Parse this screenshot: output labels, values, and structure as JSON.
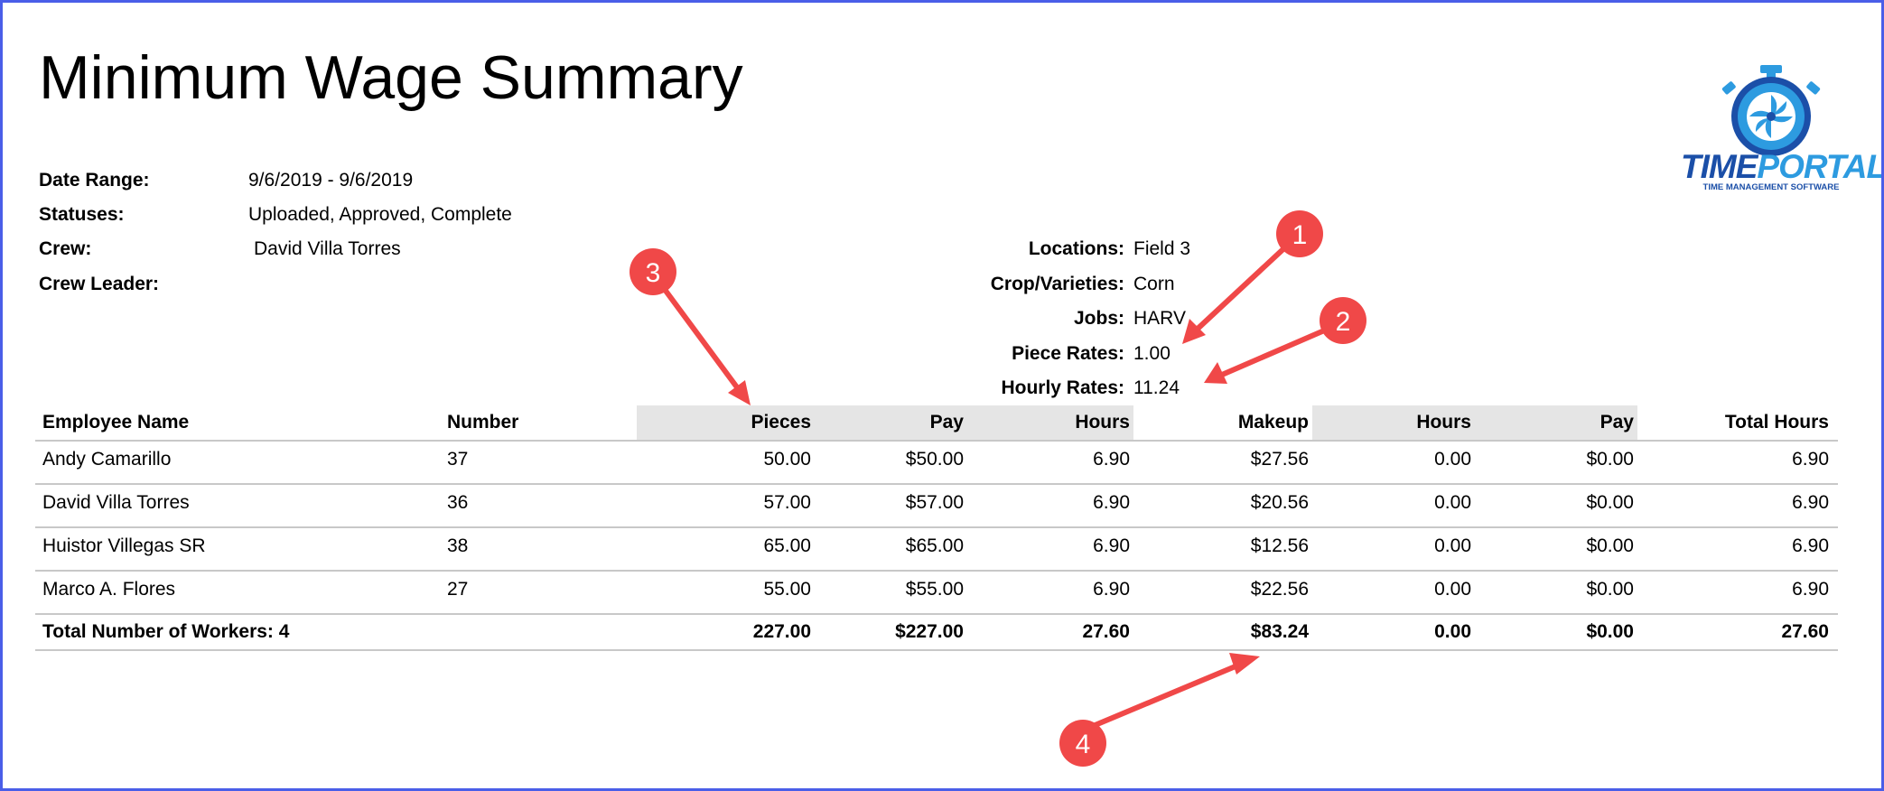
{
  "report": {
    "title": "Minimum Wage Summary"
  },
  "logo": {
    "word_part1": "TIME",
    "word_part2": "PORTAL",
    "tagline": "TIME MANAGEMENT SOFTWARE"
  },
  "filters_left": [
    {
      "label": "Date Range:",
      "value": "9/6/2019 - 9/6/2019"
    },
    {
      "label": "Statuses:",
      "value": "Uploaded, Approved, Complete"
    },
    {
      "label": "Crew:",
      "value": "David Villa Torres"
    },
    {
      "label": "Crew Leader:",
      "value": ""
    }
  ],
  "filters_right": [
    {
      "label": "Locations:",
      "value": "Field 3"
    },
    {
      "label": "Crop/Varieties:",
      "value": "Corn"
    },
    {
      "label": "Jobs:",
      "value": "HARV"
    },
    {
      "label": "Piece Rates:",
      "value": "1.00"
    },
    {
      "label": "Hourly Rates:",
      "value": "11.24"
    }
  ],
  "table": {
    "headers": [
      "Employee Name",
      "Number",
      "Pieces",
      "Pay",
      "Hours",
      "Makeup",
      "Hours",
      "Pay",
      "Total Hours"
    ],
    "rows": [
      [
        "Andy Camarillo",
        "37",
        "50.00",
        "$50.00",
        "6.90",
        "$27.56",
        "0.00",
        "$0.00",
        "6.90"
      ],
      [
        "David Villa Torres",
        "36",
        "57.00",
        "$57.00",
        "6.90",
        "$20.56",
        "0.00",
        "$0.00",
        "6.90"
      ],
      [
        "Huistor Villegas SR",
        "38",
        "65.00",
        "$65.00",
        "6.90",
        "$12.56",
        "0.00",
        "$0.00",
        "6.90"
      ],
      [
        "Marco A. Flores",
        "27",
        "55.00",
        "$55.00",
        "6.90",
        "$22.56",
        "0.00",
        "$0.00",
        "6.90"
      ]
    ],
    "totals": [
      "Total Number of Workers: 4",
      "",
      "227.00",
      "$227.00",
      "27.60",
      "$83.24",
      "0.00",
      "$0.00",
      "27.60"
    ]
  },
  "annotations": [
    "1",
    "2",
    "3",
    "4"
  ],
  "colors": {
    "border": "#4a5ee8",
    "annotation": "#f04848",
    "header_shade": "#e5e5e5",
    "logo_dark": "#1b4fa8",
    "logo_light": "#2d9be0"
  }
}
